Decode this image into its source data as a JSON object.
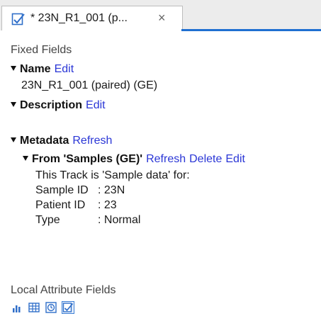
{
  "tab": {
    "icon": "document-edit-icon",
    "title": "* 23N_R1_001 (p...",
    "close": "×"
  },
  "fixed_fields": {
    "heading": "Fixed Fields",
    "name_label": "Name",
    "name_edit": "Edit",
    "name_value": "23N_R1_001 (paired) (GE)",
    "description_label": "Description",
    "description_edit": "Edit"
  },
  "metadata": {
    "label": "Metadata",
    "refresh": "Refresh",
    "source_label": "From 'Samples (GE)'",
    "source_refresh": "Refresh",
    "source_delete": "Delete",
    "source_edit": "Edit",
    "note": "This Track is 'Sample data' for:",
    "items": [
      {
        "key": "Sample ID",
        "value": ": 23N"
      },
      {
        "key": "Patient ID",
        "value": ": 23"
      },
      {
        "key": "Type",
        "value": ": Normal"
      }
    ]
  },
  "local_attributes": {
    "heading": "Local Attribute Fields",
    "tools": [
      "bar-chart-icon",
      "table-icon",
      "clock-icon",
      "document-edit-icon"
    ]
  },
  "colors": {
    "link": "#2a36d6",
    "accent": "#1f6fd1"
  }
}
